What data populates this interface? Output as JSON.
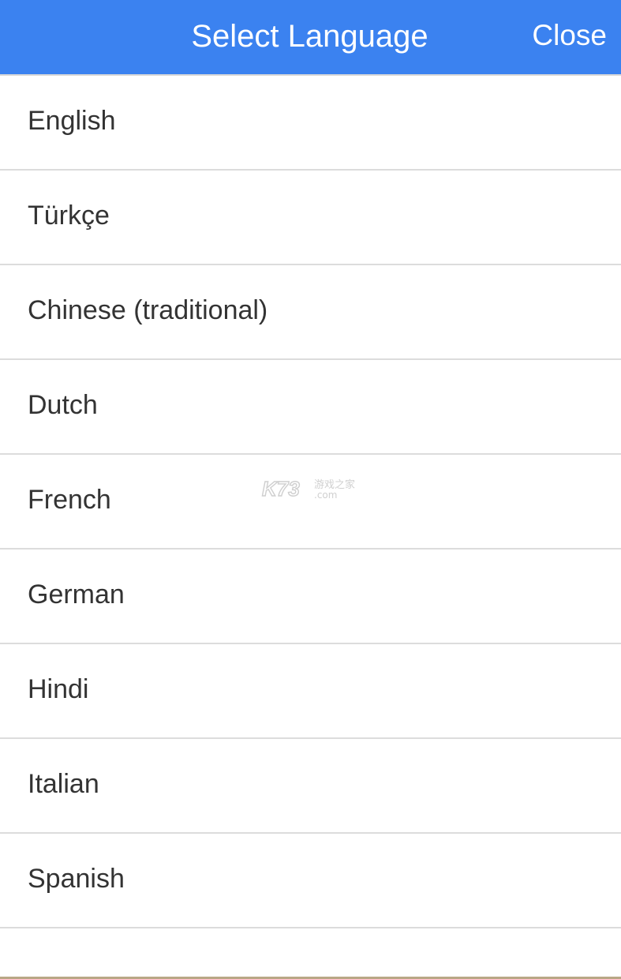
{
  "header": {
    "title": "Select Language",
    "close_label": "Close",
    "background_color": "#3b82f0"
  },
  "languages": [
    {
      "label": "English"
    },
    {
      "label": "Türkçe"
    },
    {
      "label": "Chinese (traditional)"
    },
    {
      "label": "Dutch"
    },
    {
      "label": "French"
    },
    {
      "label": "German"
    },
    {
      "label": "Hindi"
    },
    {
      "label": "Italian"
    },
    {
      "label": "Spanish"
    }
  ],
  "watermark": {
    "brand": "K73",
    "cn_text": "游戏之家",
    "domain": ".com"
  }
}
